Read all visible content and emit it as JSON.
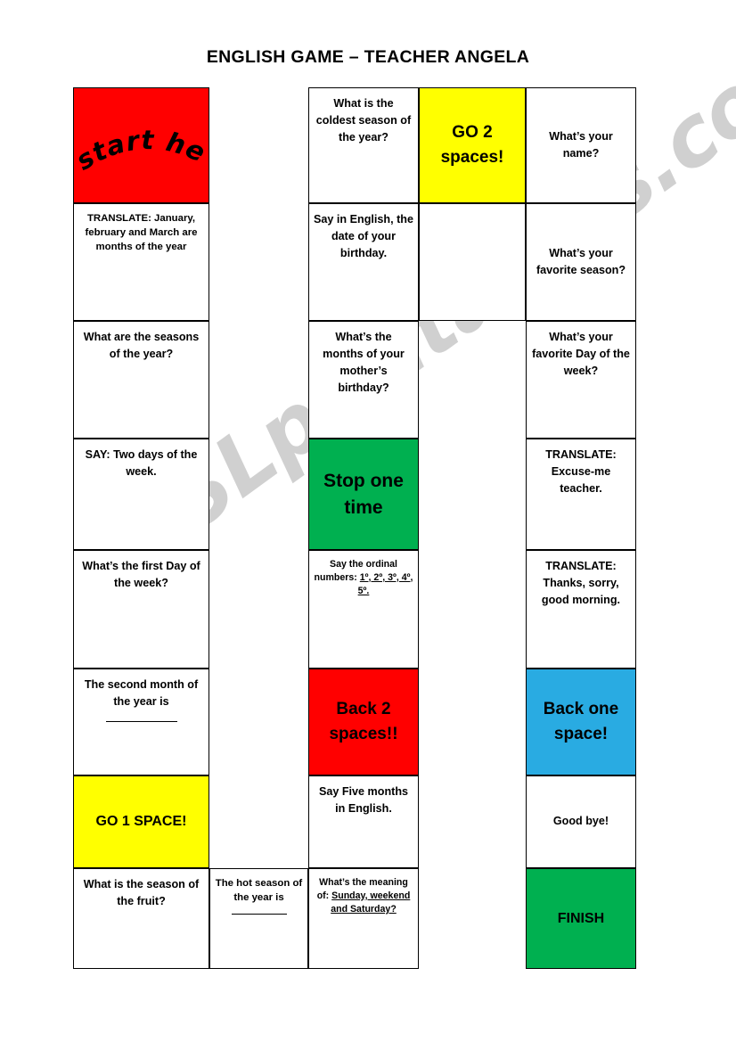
{
  "page": {
    "title": "ENGLISH GAME – TEACHER ANGELA",
    "watermark": "ESLprintables.com"
  },
  "colors": {
    "red": "#FF0000",
    "yellow": "#FFFF00",
    "green": "#00B050",
    "green_dark": "#00A64F",
    "blue": "#29ABE2",
    "white": "#FFFFFF",
    "border": "#000000",
    "watermark": "#C8C8C8"
  },
  "board": {
    "start_label": "start here",
    "columns": [
      {
        "id": "column-1",
        "cells": [
          {
            "id": "start-here",
            "text": "start here",
            "fill": "red",
            "style": "wordart"
          },
          {
            "id": "translate-months",
            "text": "TRANSLATE: January, february and March are months of the year",
            "fill": "white",
            "style": "normal"
          },
          {
            "id": "seasons-of-year",
            "text": "What are the seasons of the year?",
            "fill": "white",
            "style": "normal"
          },
          {
            "id": "say-two-days",
            "text": "SAY: Two days of the week.",
            "fill": "white",
            "style": "normal"
          },
          {
            "id": "first-day-week",
            "text": "What’s the first Day of the week?",
            "fill": "white",
            "style": "normal"
          },
          {
            "id": "second-month",
            "text": "The second month of the year is____",
            "fill": "white",
            "style": "blank"
          },
          {
            "id": "go-1-space",
            "text": "GO 1 SPACE!",
            "fill": "yellow",
            "style": "action"
          },
          {
            "id": "season-of-fruit",
            "text": "What  is the season of the fruit?",
            "fill": "white",
            "style": "normal"
          }
        ]
      },
      {
        "id": "column-2",
        "cells": [
          {
            "id": "hot-season",
            "text": "The hot season of the year is ____",
            "fill": "white",
            "style": "blank"
          }
        ]
      },
      {
        "id": "column-3",
        "cells": [
          {
            "id": "coldest-season",
            "text": "What is the coldest season of the year?",
            "fill": "white",
            "style": "normal"
          },
          {
            "id": "date-of-birthday",
            "text": "Say in English, the date of your birthday.",
            "fill": "white",
            "style": "normal"
          },
          {
            "id": "mothers-birthday",
            "text": "What’s the months of your mother’s birthday?",
            "fill": "white",
            "style": "normal"
          },
          {
            "id": "stop-one-time",
            "text": "Stop one time",
            "fill": "green",
            "style": "action-big"
          },
          {
            "id": "ordinal-numbers",
            "text": "Say the ordinal numbers: 1º, 2º, 3º, 4º, 5º.",
            "fill": "white",
            "style": "underline-tail"
          },
          {
            "id": "back-2-spaces",
            "text": "Back 2 spaces!!",
            "fill": "red",
            "style": "action-big"
          },
          {
            "id": "say-five-months",
            "text": "Say Five months in English.",
            "fill": "white",
            "style": "normal"
          },
          {
            "id": "meaning-of-days",
            "text": "What’s the meaning of: Sunday, weekend and Saturday?",
            "fill": "white",
            "style": "underline-tail2"
          }
        ]
      },
      {
        "id": "column-4",
        "cells": [
          {
            "id": "go-2-spaces",
            "text": "GO 2 spaces!",
            "fill": "yellow",
            "style": "action-big"
          },
          {
            "id": "empty-spacer",
            "text": "",
            "fill": "white",
            "style": "empty"
          }
        ]
      },
      {
        "id": "column-5",
        "cells": [
          {
            "id": "whats-your-name",
            "text": "What’s your name?",
            "fill": "white",
            "style": "normal"
          },
          {
            "id": "favorite-season",
            "text": "What’s your favorite season?",
            "fill": "white",
            "style": "normal"
          },
          {
            "id": "favorite-day",
            "text": "What’s your favorite Day of the week?",
            "fill": "white",
            "style": "normal"
          },
          {
            "id": "translate-excuse",
            "text": "TRANSLATE: Excuse-me teacher.",
            "fill": "white",
            "style": "normal"
          },
          {
            "id": "translate-thanks",
            "text": "TRANSLATE: Thanks, sorry, good morning.",
            "fill": "white",
            "style": "normal"
          },
          {
            "id": "back-one-space",
            "text": "Back one space!",
            "fill": "blue",
            "style": "action-big"
          },
          {
            "id": "good-bye",
            "text": "Good bye!",
            "fill": "white",
            "style": "normal"
          },
          {
            "id": "finish",
            "text": "FINISH",
            "fill": "green",
            "style": "action-mid"
          }
        ]
      }
    ],
    "fragments": {
      "translate_label": "TRANSLATE:",
      "translate_months_body": "January, february and March are months of the year",
      "second_month_prefix": "The second month of the year is",
      "hot_season_prefix": "The hot season of the year is",
      "ordinal_prefix": "Say the ordinal numbers:",
      "ordinal_values": "1º, 2º, 3º, 4º, 5º.",
      "meaning_prefix": "What’s the meaning of:",
      "meaning_values": "Sunday, weekend and Saturday?"
    }
  }
}
